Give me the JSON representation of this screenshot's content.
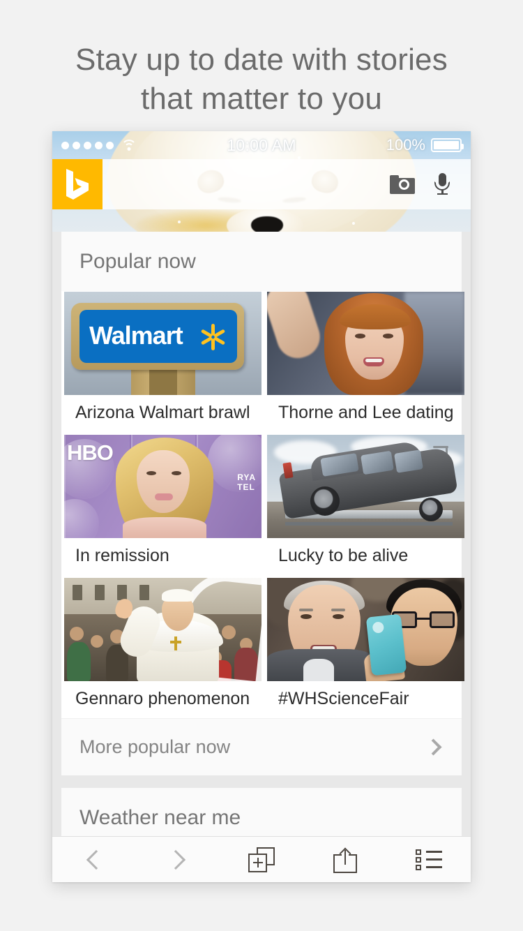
{
  "marketing": {
    "headline_line1": "Stay up to date with stories",
    "headline_line2": "that matter to you"
  },
  "status_bar": {
    "signal_label": "signal-strength",
    "signal_dots": 5,
    "wifi_label": "wifi",
    "time": "10:00 AM",
    "battery_percent": "100%",
    "battery_level": 100
  },
  "search_bar": {
    "logo_label": "Bing",
    "logo_color": "#FFB900",
    "input_value": "",
    "input_placeholder": "",
    "camera_icon": "camera-icon",
    "mic_icon": "microphone-icon"
  },
  "hero": {
    "description": "polar bear sleeping in snow",
    "sky_color": "#B9D9EF",
    "fur_color": "#F6EFDD"
  },
  "sections": [
    {
      "id": "popular-now",
      "title": "Popular now",
      "tiles": [
        {
          "caption": "Arizona Walmart brawl",
          "art": "walmart"
        },
        {
          "caption": "Thorne and Lee dating",
          "art": "thorne"
        },
        {
          "caption": "In remission",
          "art": "hbo"
        },
        {
          "caption": "Lucky to be alive",
          "art": "car"
        },
        {
          "caption": "Gennaro phenomenon",
          "art": "pope"
        },
        {
          "caption": "#WHScienceFair",
          "art": "nye"
        }
      ],
      "more_label": "More popular now",
      "more_icon": "chevron-right-icon"
    },
    {
      "id": "weather-near-me",
      "title": "Weather near me"
    }
  ],
  "tile_art_text": {
    "walmart_brand": "Walmart",
    "hbo_brand": "HBO",
    "hbo_sponsor": "RYA\nTEL"
  },
  "toolbar": {
    "back_label": "Back",
    "back_icon": "chevron-left-icon",
    "forward_label": "Forward",
    "forward_icon": "chevron-right-icon",
    "newtab_label": "New tab",
    "newtab_icon": "new-tab-icon",
    "share_label": "Share",
    "share_icon": "share-icon",
    "menu_label": "Menu",
    "menu_icon": "list-menu-icon"
  },
  "colors": {
    "page_background": "#F2F2F2",
    "card_background": "#FFFFFF",
    "section_header_background": "#FAFAFA",
    "content_gap": "#E8E8E8",
    "headline_text": "#6B6B6B",
    "caption_text": "#2B2B2B",
    "muted_text": "#848484",
    "toolbar_icon": "#4C4640",
    "toolbar_nav_disabled": "#B4B4B4"
  }
}
